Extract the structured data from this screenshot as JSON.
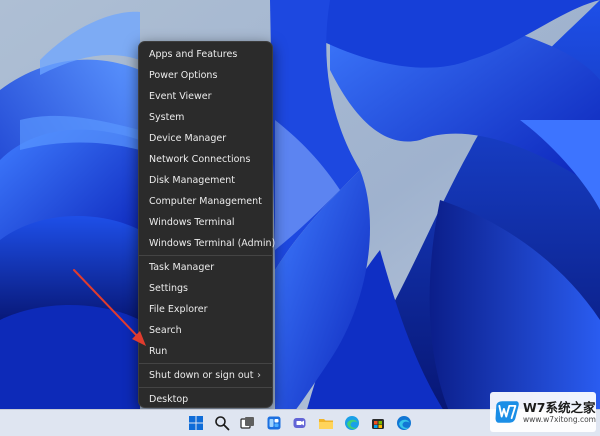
{
  "context_menu": {
    "groups": [
      [
        "Apps and Features",
        "Power Options",
        "Event Viewer",
        "System",
        "Device Manager",
        "Network Connections",
        "Disk Management",
        "Computer Management",
        "Windows Terminal",
        "Windows Terminal (Admin)"
      ],
      [
        "Task Manager",
        "Settings",
        "File Explorer",
        "Search",
        "Run"
      ],
      [
        "Shut down or sign out"
      ],
      [
        "Desktop"
      ]
    ],
    "submenu_indicator": "›",
    "highlighted_item": "Run"
  },
  "annotation": {
    "type": "arrow",
    "color": "#e03c2e",
    "points_to": "Run"
  },
  "taskbar": {
    "icons": [
      "windows-start-icon",
      "search-icon",
      "task-view-icon",
      "widgets-icon",
      "teams-chat-icon",
      "file-explorer-icon",
      "edge-icon",
      "microsoft-store-icon",
      "edge-icon-2"
    ]
  },
  "watermark": {
    "title": "W7系统之家",
    "url": "www.w7xitong.com"
  },
  "colors": {
    "menu_bg": "#2b2b2b",
    "menu_text": "#ececec",
    "wallpaper": "#1a3bd6",
    "taskbar_bg": "#dfe5f1"
  }
}
